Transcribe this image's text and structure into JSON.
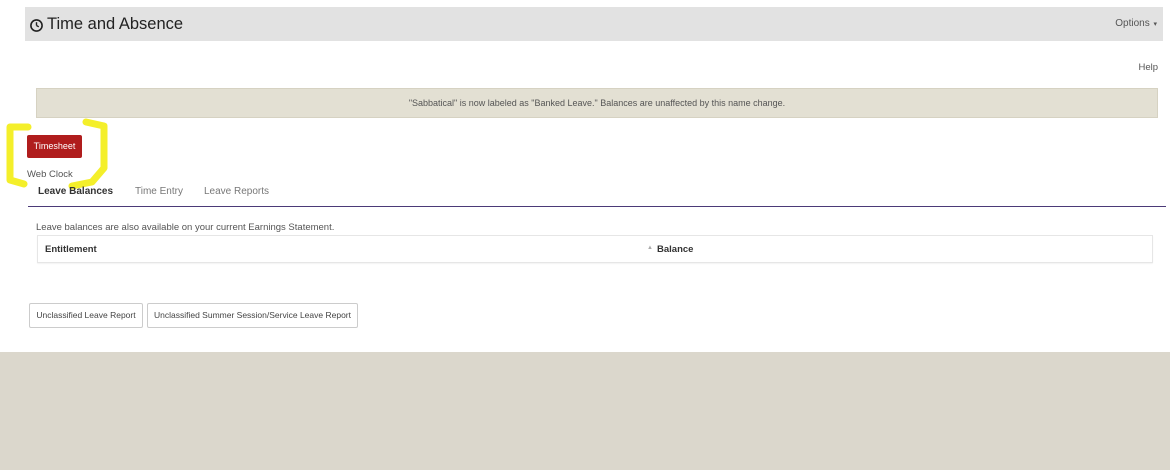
{
  "app": {
    "title": "Time and Absence",
    "title_icon": "clock-icon"
  },
  "header": {
    "options_label": "Options",
    "options_caret": "▾"
  },
  "help_label": "Help",
  "notice": {
    "text": "\"Sabbatical\" is now labeled as \"Banked Leave.\" Balances are unaffected by this name change."
  },
  "actions": {
    "timesheet_label": "Timesheet",
    "web_clock_label": "Web Clock"
  },
  "tabs": [
    {
      "label": "Leave Balances",
      "active": true
    },
    {
      "label": "Time Entry",
      "active": false
    },
    {
      "label": "Leave Reports",
      "active": false
    }
  ],
  "leave_balances": {
    "info_text": "Leave balances are also available on your current Earnings Statement.",
    "columns": [
      "Entitlement",
      "Balance"
    ],
    "sort_indicator": "▲",
    "rows": []
  },
  "report_buttons": [
    {
      "label": "Unclassified Leave Report"
    },
    {
      "label": "Unclassified Summer Session/Service Leave Report"
    }
  ],
  "colors": {
    "accent_red": "#b01d1d",
    "tab_underline": "#4b3a78",
    "banner_bg": "#e3e0d3",
    "header_bg": "#e2e2e2",
    "footer_bg": "#dbd7cc",
    "highlight_yellow": "#f4ef2a"
  }
}
